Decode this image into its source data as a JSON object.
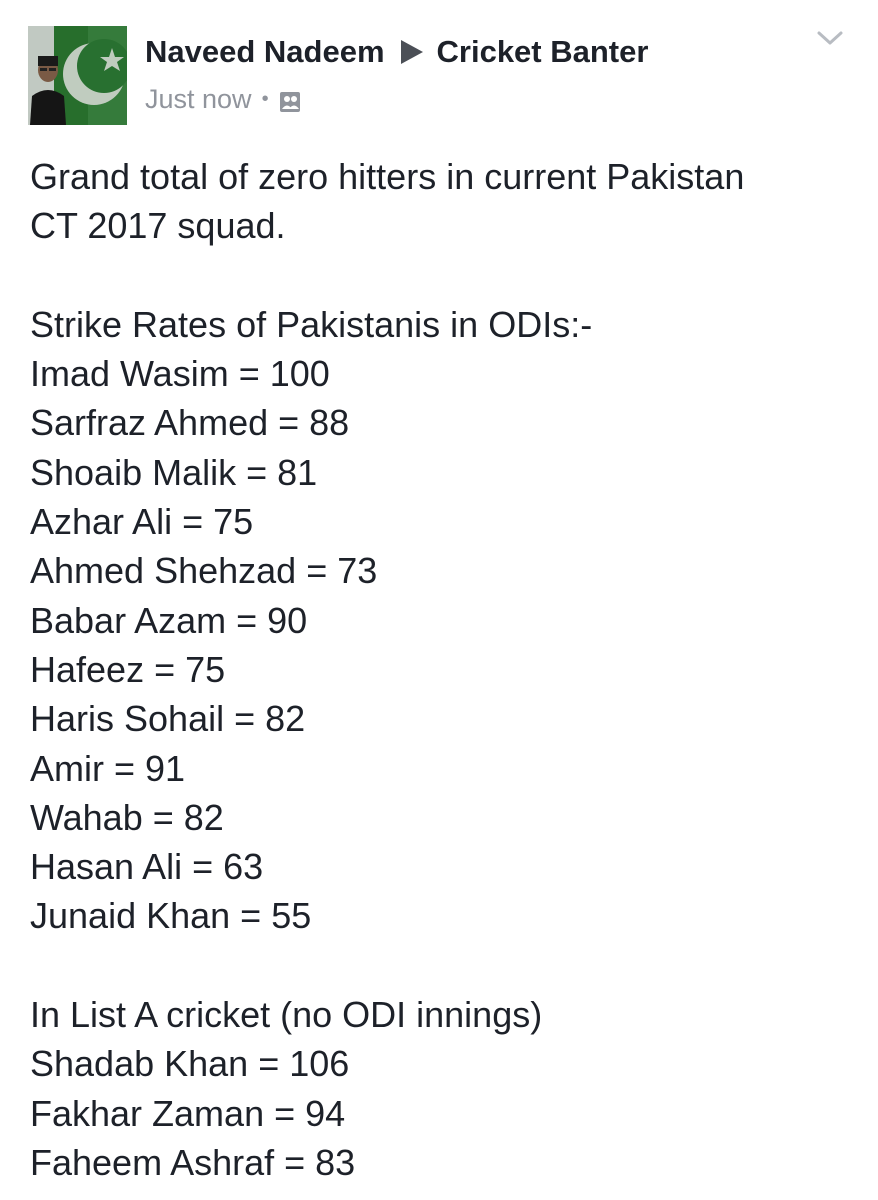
{
  "post": {
    "author": "Naveed Nadeem",
    "group": "Cricket Banter",
    "timestamp": "Just now",
    "separator": "•",
    "audience_icon": "group-icon",
    "menu_icon": "chevron-down-icon",
    "avatar_icon": "pakistan-flag-profile-photo"
  },
  "content": {
    "intro_lines": [
      "Grand total of zero hitters in current Pakistan",
      "CT 2017 squad."
    ],
    "odi_heading": "Strike Rates of Pakistanis in ODIs:-",
    "odi_rates": [
      "Imad Wasim = 100",
      "Sarfraz Ahmed = 88",
      "Shoaib Malik = 81",
      "Azhar Ali = 75",
      "Ahmed Shehzad = 73",
      "Babar Azam = 90",
      "Hafeez = 75",
      "Haris Sohail = 82",
      "Amir = 91",
      "Wahab = 82",
      "Hasan Ali = 63",
      "Junaid Khan = 55"
    ],
    "lista_heading": "In List A cricket (no ODI innings)",
    "lista_rates": [
      "Shadab Khan = 106",
      "Fakhar Zaman = 94",
      "Faheem Ashraf = 83"
    ]
  },
  "colors": {
    "text": "#1d2129",
    "meta": "#90949c",
    "flag_green": "#1b5e20"
  }
}
